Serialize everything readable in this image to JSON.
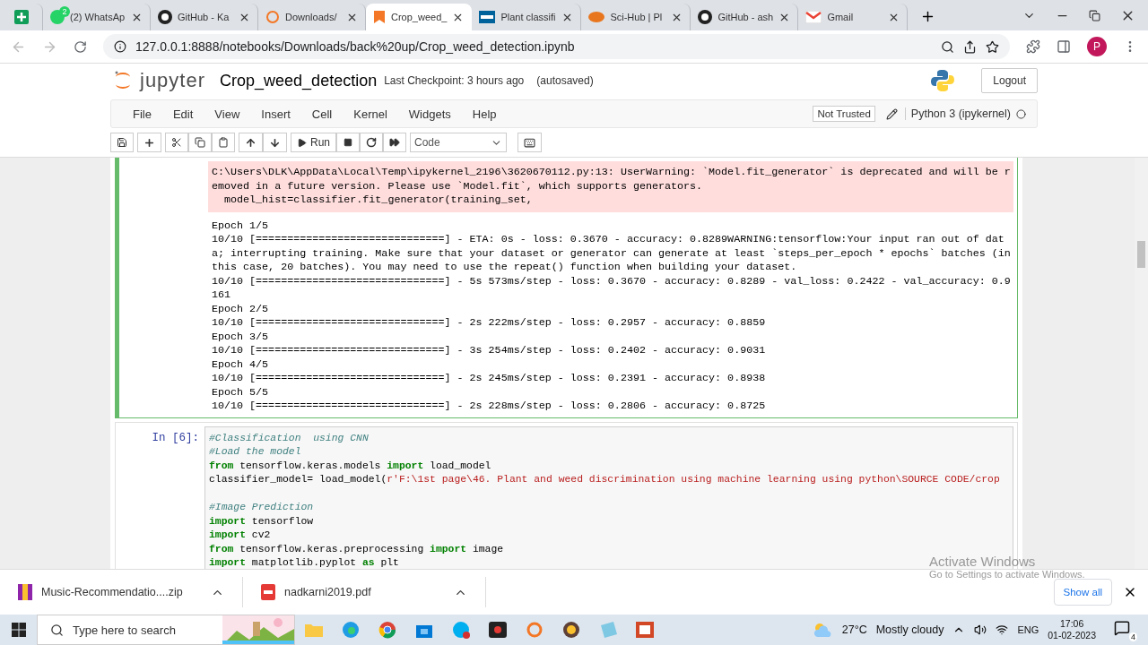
{
  "browser": {
    "tabs": [
      {
        "kind": "sheets",
        "selected": false
      },
      {
        "kind": "whatsapp",
        "badge": "2",
        "title": "(2) WhatsAp",
        "selected": false
      },
      {
        "kind": "github",
        "title": "GitHub - Ka",
        "selected": false
      },
      {
        "kind": "spinner",
        "title": "Downloads/",
        "selected": false
      },
      {
        "kind": "jupyter",
        "title": "Crop_weed_",
        "selected": true
      },
      {
        "kind": "ieee",
        "title": "Plant classifi",
        "selected": false
      },
      {
        "kind": "scihub",
        "title": "Sci-Hub | Pl",
        "selected": false
      },
      {
        "kind": "github",
        "title": "GitHub - ash",
        "selected": false
      },
      {
        "kind": "gmail",
        "title": "Gmail",
        "selected": false
      }
    ],
    "url": "127.0.0.1:8888/notebooks/Downloads/back%20up/Crop_weed_detection.ipynb",
    "profile_initial": "P"
  },
  "jupyter": {
    "logo_text": "jupyter",
    "notebook_name": "Crop_weed_detection",
    "checkpoint": "Last Checkpoint: 3 hours ago",
    "autosave": "(autosaved)",
    "logout": "Logout",
    "menu": [
      "File",
      "Edit",
      "View",
      "Insert",
      "Cell",
      "Kernel",
      "Widgets",
      "Help"
    ],
    "trust": "Not Trusted",
    "kernel": "Python 3 (ipykernel)",
    "run_label": "Run",
    "cell_type": "Code"
  },
  "output_cell": {
    "selected": true,
    "stderr": [
      "C:\\Users\\DLK\\AppData\\Local\\Temp\\ipykernel_2196\\3620670112.py:13: UserWarning: `Model.fit_generator` is deprecated and will be r",
      "emoved in a future version. Please use `Model.fit`, which supports generators.",
      "  model_hist=classifier.fit_generator(training_set,"
    ],
    "stdout": [
      "Epoch 1/5",
      "10/10 [==============================] - ETA: 0s - loss: 0.3670 - accuracy: 0.8289WARNING:tensorflow:Your input ran out of dat",
      "a; interrupting training. Make sure that your dataset or generator can generate at least `steps_per_epoch * epochs` batches (in",
      "this case, 20 batches). You may need to use the repeat() function when building your dataset.",
      "10/10 [==============================] - 5s 573ms/step - loss: 0.3670 - accuracy: 0.8289 - val_loss: 0.2422 - val_accuracy: 0.9",
      "161",
      "Epoch 2/5",
      "10/10 [==============================] - 2s 222ms/step - loss: 0.2957 - accuracy: 0.8859",
      "Epoch 3/5",
      "10/10 [==============================] - 3s 254ms/step - loss: 0.2402 - accuracy: 0.9031",
      "Epoch 4/5",
      "10/10 [==============================] - 2s 245ms/step - loss: 0.2391 - accuracy: 0.8938",
      "Epoch 5/5",
      "10/10 [==============================] - 2s 228ms/step - loss: 0.2806 - accuracy: 0.8725"
    ]
  },
  "code_cell": {
    "selected": false,
    "prompt": "In [6]:",
    "lines": [
      {
        "kind": "code",
        "tokens": [
          {
            "kind": "comment",
            "t": "#Classification  using CNN"
          }
        ]
      },
      {
        "kind": "code",
        "tokens": [
          {
            "kind": "comment",
            "t": "#Load the model"
          }
        ]
      },
      {
        "kind": "code",
        "tokens": [
          {
            "kind": "kw",
            "t": "from"
          },
          {
            "kind": "plain",
            "t": " tensorflow.keras.models "
          },
          {
            "kind": "kw",
            "t": "import"
          },
          {
            "kind": "plain",
            "t": " load_model"
          }
        ]
      },
      {
        "kind": "code",
        "tokens": [
          {
            "kind": "plain",
            "t": "classifier_model= load_model("
          },
          {
            "kind": "str",
            "t": "r'F:\\1st page\\46. Plant and weed discrimination using machine learning using python\\SOURCE CODE/crop"
          }
        ]
      },
      {
        "kind": "blank"
      },
      {
        "kind": "code",
        "tokens": [
          {
            "kind": "comment",
            "t": "#Image Prediction"
          }
        ]
      },
      {
        "kind": "code",
        "tokens": [
          {
            "kind": "kw",
            "t": "import"
          },
          {
            "kind": "plain",
            "t": " tensorflow"
          }
        ]
      },
      {
        "kind": "code",
        "tokens": [
          {
            "kind": "kw",
            "t": "import"
          },
          {
            "kind": "plain",
            "t": " cv2"
          }
        ]
      },
      {
        "kind": "code",
        "tokens": [
          {
            "kind": "kw",
            "t": "from"
          },
          {
            "kind": "plain",
            "t": " tensorflow.keras.preprocessing "
          },
          {
            "kind": "kw",
            "t": "import"
          },
          {
            "kind": "plain",
            "t": " image"
          }
        ]
      },
      {
        "kind": "code",
        "tokens": [
          {
            "kind": "kw",
            "t": "import"
          },
          {
            "kind": "plain",
            "t": " matplotlib.pyplot "
          },
          {
            "kind": "kw",
            "t": "as"
          },
          {
            "kind": "plain",
            "t": " plt"
          }
        ]
      }
    ]
  },
  "activation": {
    "title": "Activate Windows",
    "hint": "Go to Settings to activate Windows."
  },
  "downloads": {
    "items": [
      {
        "kind": "archive",
        "name": "Music-Recommendatio....zip"
      },
      {
        "kind": "pdf",
        "name": "nadkarni2019.pdf"
      }
    ],
    "show_all": "Show all"
  },
  "taskbar": {
    "search_placeholder": "Type here to search",
    "temperature": "27°C",
    "weather": "Mostly cloudy",
    "language": "ENG",
    "time": "17:06",
    "date": "01-02-2023",
    "notifications": "4"
  }
}
